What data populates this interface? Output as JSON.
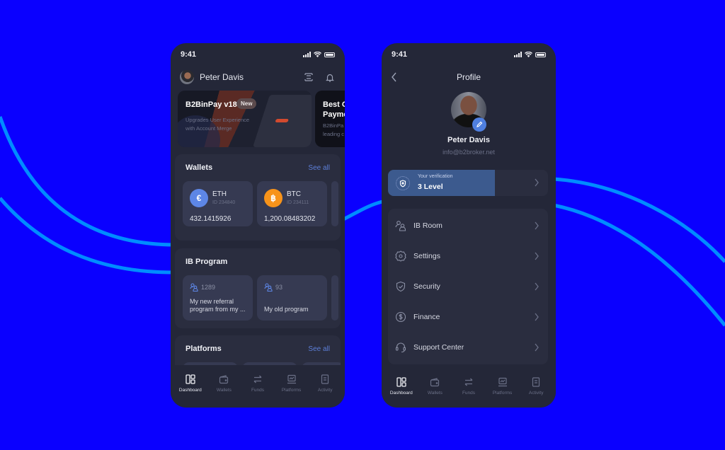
{
  "background": {
    "color": "#0a00ff",
    "curve_color": "#008cff"
  },
  "dashboard": {
    "status_bar": {
      "time": "9:41"
    },
    "header": {
      "user_name": "Peter Davis",
      "icons": [
        "scan-icon",
        "bell-icon"
      ]
    },
    "banners": [
      {
        "title": "B2BinPay v18",
        "badge": "New",
        "description_line1": "Upgrades User Experience",
        "description_line2": "with Account Merge"
      },
      {
        "title_line1": "Best C",
        "title_line2": "Payme",
        "description_line1": "B2BinPa",
        "description_line2": "leading c"
      }
    ],
    "wallets": {
      "title": "Wallets",
      "see_all": "See all",
      "items": [
        {
          "symbol": "ETH",
          "id": "ID 234840",
          "balance": "432.1415926",
          "icon": "ethereum-icon",
          "color": "#5d86e6",
          "glyph": "€"
        },
        {
          "symbol": "BTC",
          "id": "ID 234111",
          "balance": "1,200.08483202",
          "icon": "bitcoin-icon",
          "color": "#f7931a",
          "glyph": "฿"
        }
      ]
    },
    "ib_program": {
      "title": "IB Program",
      "items": [
        {
          "count": "1289",
          "name": "My new referral program from my ..."
        },
        {
          "count": "93",
          "name": "My old program"
        }
      ]
    },
    "platforms": {
      "title": "Platforms",
      "see_all": "See all"
    }
  },
  "profile": {
    "status_bar": {
      "time": "9:41"
    },
    "title": "Profile",
    "user_name": "Peter Davis",
    "email": "info@b2broker.net",
    "verification": {
      "label": "Your verification",
      "level": "3 Level",
      "progress": 0.67
    },
    "menu": [
      {
        "label": "IB Room",
        "icon": "ib-room-icon"
      },
      {
        "label": "Settings",
        "icon": "settings-icon"
      },
      {
        "label": "Security",
        "icon": "security-shield-icon"
      },
      {
        "label": "Finance",
        "icon": "finance-dollar-icon"
      },
      {
        "label": "Support Center",
        "icon": "headset-icon"
      }
    ]
  },
  "bottom_nav": [
    {
      "label": "Dashboard",
      "icon": "dashboard-icon",
      "active": true
    },
    {
      "label": "Wallets",
      "icon": "wallet-icon",
      "active": false
    },
    {
      "label": "Funds",
      "icon": "transfer-icon",
      "active": false
    },
    {
      "label": "Platforms",
      "icon": "platforms-icon",
      "active": false
    },
    {
      "label": "Activity",
      "icon": "activity-icon",
      "active": false
    }
  ]
}
